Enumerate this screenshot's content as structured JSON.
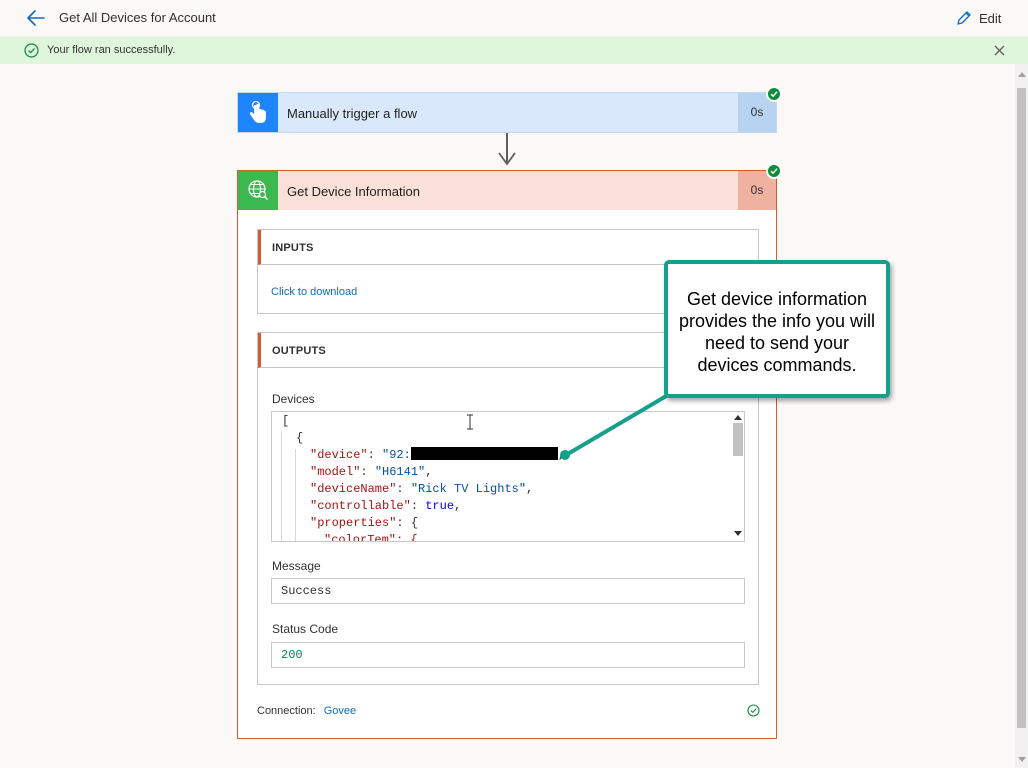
{
  "header": {
    "title": "Get All Devices for Account",
    "edit_label": "Edit"
  },
  "banner": {
    "message": "Your flow ran successfully."
  },
  "trigger": {
    "title": "Manually trigger a flow",
    "duration": "0s"
  },
  "action": {
    "title": "Get Device Information",
    "duration": "0s",
    "inputs": {
      "heading": "INPUTS",
      "download_link": "Click to download"
    },
    "outputs": {
      "heading": "OUTPUTS",
      "devices_label": "Devices",
      "json": {
        "open_bracket": "[",
        "open_brace": "{",
        "device_key": "\"device\"",
        "device_value_visible": "\"92:",
        "model_key": "\"model\"",
        "model_value": "\"H6141\"",
        "device_name_key": "\"deviceName\"",
        "device_name_value": "\"Rick TV Lights\"",
        "controllable_key": "\"controllable\"",
        "controllable_value": "true",
        "properties_key": "\"properties\"",
        "properties_open": "{",
        "partial_line": "\"colorTem\": {"
      },
      "message_label": "Message",
      "message_value": "Success",
      "status_label": "Status Code",
      "status_value": "200"
    },
    "connection_label": "Connection:",
    "connection_value": "Govee"
  },
  "callout": {
    "text": "Get device information provides the info you will need to send your devices commands."
  },
  "colors": {
    "trigger_blue": "#1f85ff",
    "action_green": "#3bb94e",
    "action_border": "#d65a34",
    "success_green": "#0e8a3c",
    "callout_teal": "#15a08c",
    "link_blue": "#0f6cbd"
  }
}
